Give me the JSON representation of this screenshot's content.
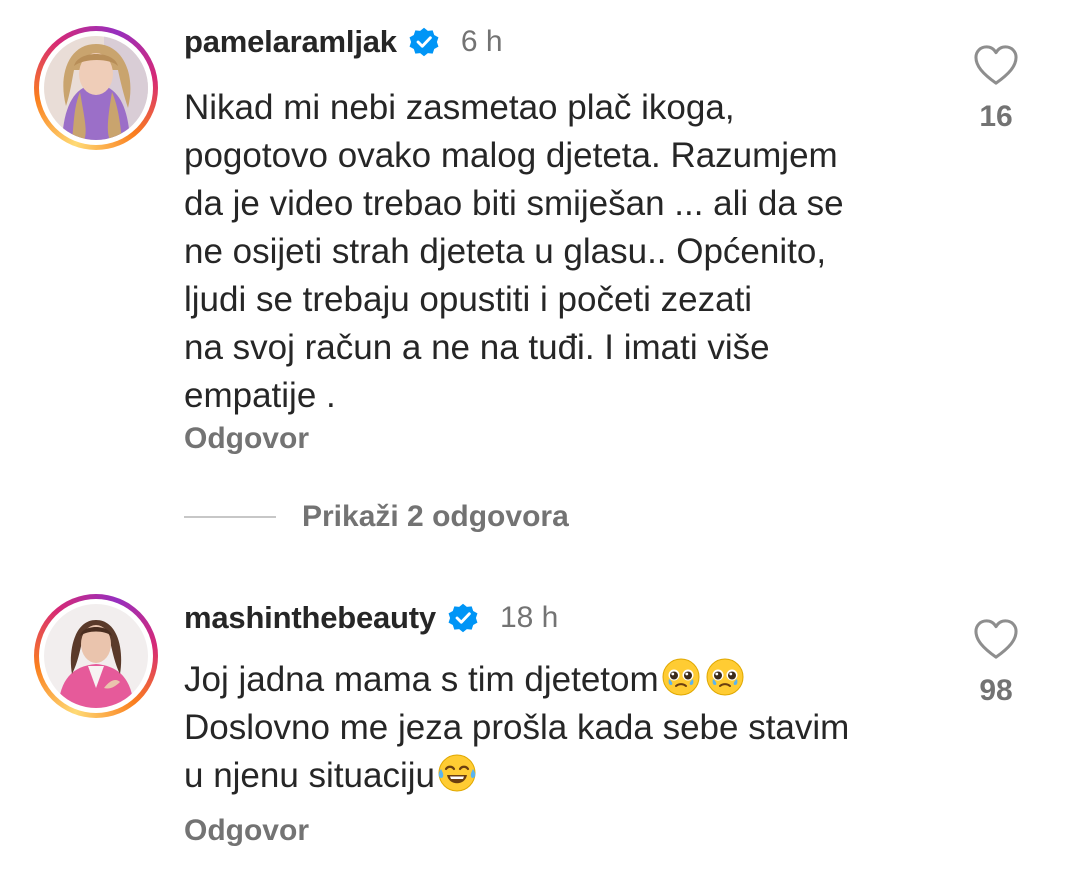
{
  "comments": [
    {
      "username": "pamelaramljak",
      "verified": true,
      "time": "6 h",
      "text_lines": [
        "Nikad mi nebi zasmetao plač ikoga,",
        "pogotovo ovako malog djeteta. Razumjem",
        "da je video trebao biti smiješan ... ali da se",
        "ne osijeti strah djeteta u glasu.. Općenito,",
        "ljudi se trebaju opustiti i početi zezati",
        "na svoj račun a ne na tuđi. I imati više",
        "empatije ."
      ],
      "reply_label": "Odgovor",
      "likes": "16",
      "view_replies_label": "Prikaži 2 odgovora"
    },
    {
      "username": "mashinthebeauty",
      "verified": true,
      "time": "18 h",
      "text_lines": [
        "Joj jadna mama s tim djetetom",
        "Doslovno me jeza prošla kada sebe stavim",
        "u njenu situaciju"
      ],
      "emojis": [
        "pleading-face-with-tears",
        "pleading-face-with-tears",
        "face-with-tears-of-joy"
      ],
      "reply_label": "Odgovor",
      "likes": "98"
    }
  ],
  "icons": {
    "verified": "verified-badge-icon",
    "like": "heart-outline-icon"
  },
  "colors": {
    "verified_blue": "#0095f6",
    "secondary_text": "#737373",
    "primary_text": "#262626"
  }
}
